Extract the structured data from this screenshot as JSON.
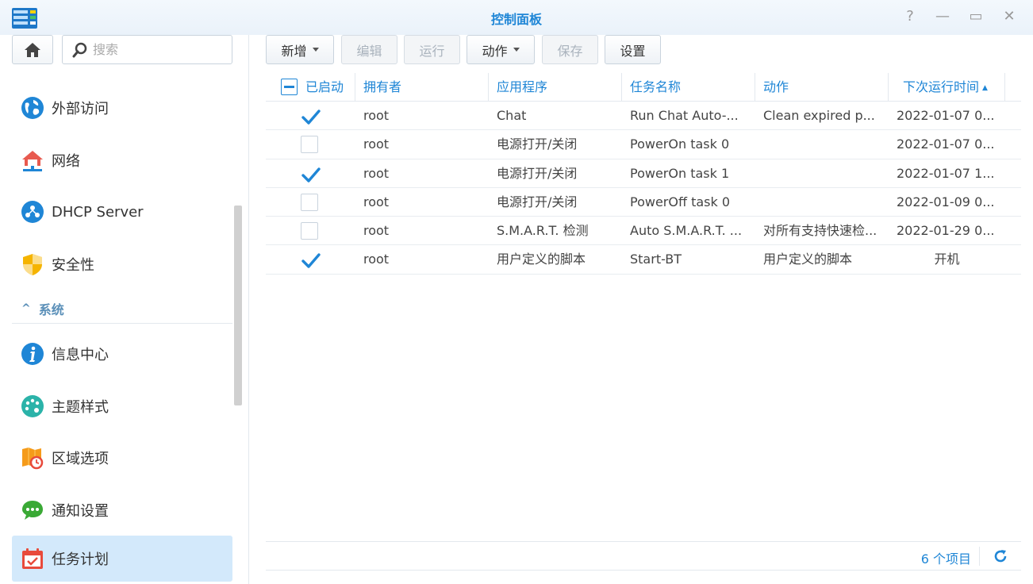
{
  "window": {
    "title": "控制面板",
    "help_glyph": "?",
    "min_glyph": "—",
    "max_glyph": "▭",
    "close_glyph": "✕"
  },
  "sidebar": {
    "search_placeholder": "搜索",
    "items_top": [
      {
        "label": "外部访问",
        "icon": "globe-icon"
      },
      {
        "label": "网络",
        "icon": "network-house-icon"
      },
      {
        "label": "DHCP Server",
        "icon": "dhcp-icon"
      },
      {
        "label": "安全性",
        "icon": "shield-icon"
      }
    ],
    "section": {
      "label": "系统",
      "chevron": "^"
    },
    "items_system": [
      {
        "label": "信息中心",
        "icon": "info-icon"
      },
      {
        "label": "主题样式",
        "icon": "palette-icon"
      },
      {
        "label": "区域选项",
        "icon": "map-clock-icon"
      },
      {
        "label": "通知设置",
        "icon": "chat-bubble-icon"
      },
      {
        "label": "任务计划",
        "icon": "calendar-check-icon",
        "active": true
      }
    ]
  },
  "toolbar": {
    "add": "新增",
    "edit": "编辑",
    "run": "运行",
    "action": "动作",
    "save": "保存",
    "settings": "设置"
  },
  "table": {
    "columns": [
      "已启动",
      "拥有者",
      "应用程序",
      "任务名称",
      "动作",
      "下次运行时间"
    ],
    "sort_indicator": "▲",
    "rows": [
      {
        "enabled": true,
        "owner": "root",
        "app": "Chat",
        "task": "Run Chat Auto-...",
        "action": "Clean expired p...",
        "next": "2022-01-07 0..."
      },
      {
        "enabled": false,
        "owner": "root",
        "app": "电源打开/关闭",
        "task": "PowerOn task 0",
        "action": "",
        "next": "2022-01-07 0..."
      },
      {
        "enabled": true,
        "owner": "root",
        "app": "电源打开/关闭",
        "task": "PowerOn task 1",
        "action": "",
        "next": "2022-01-07 1..."
      },
      {
        "enabled": false,
        "owner": "root",
        "app": "电源打开/关闭",
        "task": "PowerOff task 0",
        "action": "",
        "next": "2022-01-09 0..."
      },
      {
        "enabled": false,
        "owner": "root",
        "app": "S.M.A.R.T. 检测",
        "task": "Auto S.M.A.R.T. ...",
        "action": "对所有支持快速检...",
        "next": "2022-01-29 0..."
      },
      {
        "enabled": true,
        "owner": "root",
        "app": "用户定义的脚本",
        "task": "Start-BT",
        "action": "用户定义的脚本",
        "next": "开机"
      }
    ]
  },
  "footer": {
    "count": "6 个项目"
  },
  "colors": {
    "accent": "#1f86d6",
    "active_bg": "#d3e9fb"
  }
}
